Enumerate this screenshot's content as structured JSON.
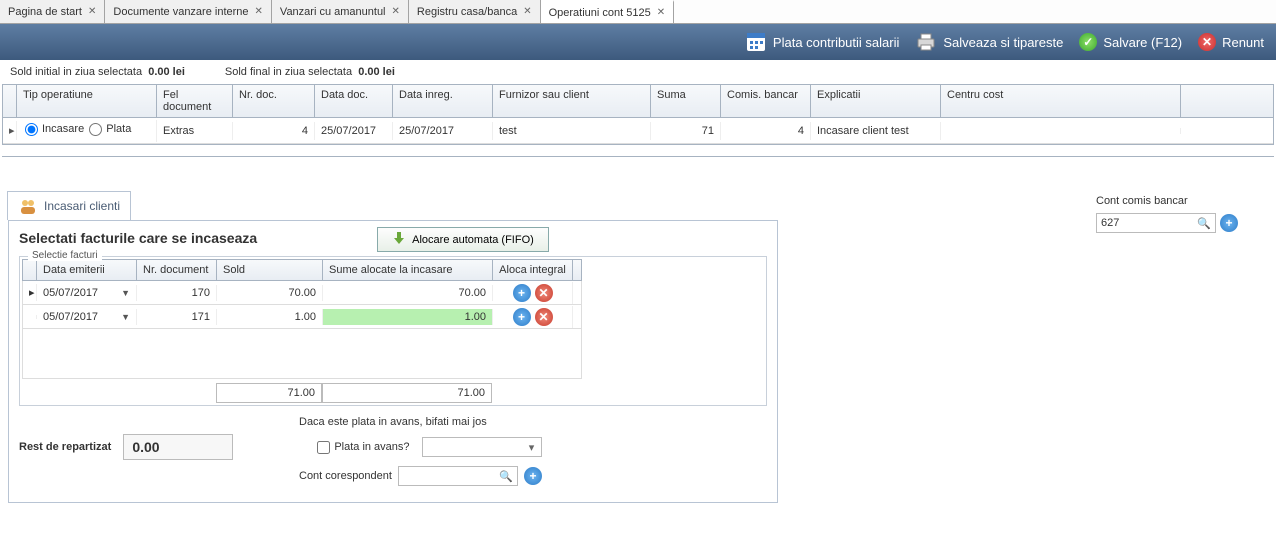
{
  "tabs": [
    "Pagina de start",
    "Documente vanzare interne",
    "Vanzari cu amanuntul",
    "Registru casa/banca",
    "Operatiuni cont 5125"
  ],
  "active_tab_index": 4,
  "toolbar": {
    "plata": "Plata contributii salarii",
    "salveaza": "Salveaza si tipareste",
    "salvare": "Salvare (F12)",
    "renunt": "Renunt"
  },
  "sold": {
    "initial_label": "Sold initial in ziua selectata",
    "initial_value": "0.00 lei",
    "final_label": "Sold final in ziua selectata",
    "final_value": "0.00 lei"
  },
  "grid": {
    "headers": {
      "tip": "Tip operatiune",
      "fel": "Fel document",
      "nrdoc": "Nr. doc.",
      "datadoc": "Data doc.",
      "datainr": "Data inreg.",
      "furn": "Furnizor sau client",
      "suma": "Suma",
      "comis": "Comis. bancar",
      "expl": "Explicatii",
      "cent": "Centru cost"
    },
    "radio": {
      "incasare": "Incasare",
      "plata": "Plata"
    },
    "row": {
      "fel": "Extras",
      "nrdoc": "4",
      "datadoc": "25/07/2017",
      "datainr": "25/07/2017",
      "furn": "test",
      "suma": "71",
      "comis": "4",
      "expl": "Incasare  client test",
      "cent": ""
    }
  },
  "subtab": "Incasari clienti",
  "panel": {
    "title": "Selectati facturile care se incaseaza",
    "fifo": "Alocare automata (FIFO)",
    "fieldset": "Selectie facturi",
    "ih": {
      "data": "Data emiterii",
      "nr": "Nr. document",
      "sold": "Sold",
      "sume": "Sume alocate la incasare",
      "aloca": "Aloca integral"
    },
    "rows": [
      {
        "data": "05/07/2017",
        "nr": "170",
        "sold": "70.00",
        "sume": "70.00",
        "hl": false
      },
      {
        "data": "05/07/2017",
        "nr": "171",
        "sold": "1.00",
        "sume": "1.00",
        "hl": true
      }
    ],
    "tot_sold": "71.00",
    "tot_sume": "71.00",
    "avans_note": "Daca este plata in avans, bifati mai jos",
    "rest_label": "Rest de repartizat",
    "rest_value": "0.00",
    "plata_avans": "Plata in avans?",
    "cont_coresp": "Cont corespondent"
  },
  "right": {
    "label": "Cont comis bancar",
    "value": "627"
  }
}
